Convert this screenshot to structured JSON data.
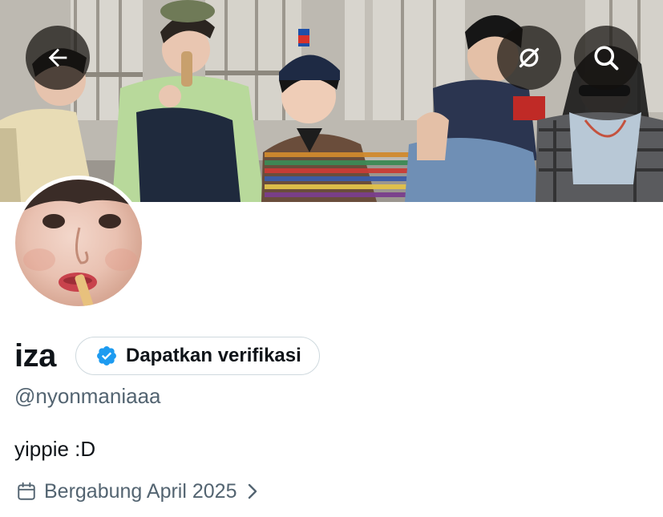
{
  "header": {
    "back_icon": "arrow-left-icon",
    "link_icon": "link-off-icon",
    "search_icon": "search-icon",
    "overlay_color": "#14100e"
  },
  "profile": {
    "display_name": "iza",
    "verification_button_label": "Dapatkan verifikasi",
    "verified_badge_icon": "verified-badge-icon",
    "verified_badge_color": "#1d9bf0",
    "handle": "@nyonmaniaaa",
    "bio": "yippie :D",
    "joined_icon": "calendar-icon",
    "joined_text": "Bergabung April 2025",
    "joined_chevron_icon": "chevron-right-icon"
  },
  "colors": {
    "primary_text": "#0f1419",
    "secondary_text": "#536471",
    "border": "#cfd9de"
  }
}
